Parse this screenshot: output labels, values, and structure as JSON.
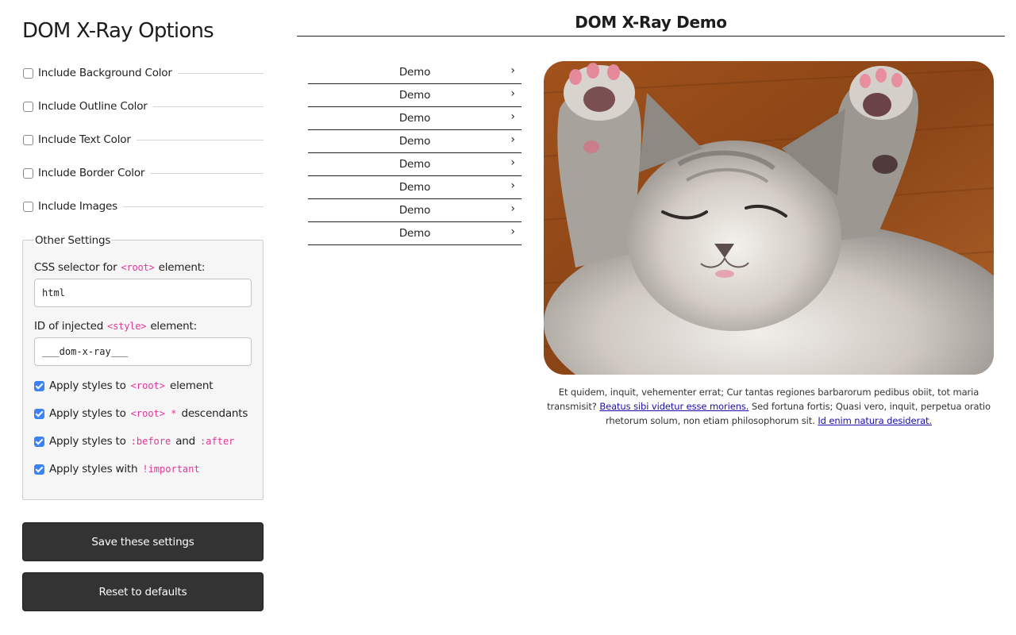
{
  "options": {
    "title": "DOM X-Ray Options",
    "toggles": [
      {
        "label": "Include Background Color",
        "checked": false
      },
      {
        "label": "Include Outline Color",
        "checked": false
      },
      {
        "label": "Include Text Color",
        "checked": false
      },
      {
        "label": "Include Border Color",
        "checked": false
      },
      {
        "label": "Include Images",
        "checked": false
      }
    ],
    "other": {
      "legend": "Other Settings",
      "root_selector": {
        "label_pre": "CSS selector for",
        "code": "<root>",
        "label_post": "element:",
        "value": "html"
      },
      "style_id": {
        "label_pre": "ID of injected",
        "code": "<style>",
        "label_post": "element:",
        "value": "___dom-x-ray___"
      },
      "checks": [
        {
          "pre": "Apply styles to",
          "code": "<root>",
          "post": "element",
          "checked": true
        },
        {
          "pre": "Apply styles to",
          "code": "<root> *",
          "post": "descendants",
          "checked": true
        },
        {
          "pre": "Apply styles to",
          "code": ":before",
          "mid": "and",
          "code2": ":after",
          "checked": true
        },
        {
          "pre": "Apply styles with",
          "code": "!important",
          "checked": true
        }
      ]
    },
    "save_label": "Save these settings",
    "reset_label": "Reset to defaults"
  },
  "demo": {
    "title": "DOM X-Ray Demo",
    "menu": [
      "Demo",
      "Demo",
      "Demo",
      "Demo",
      "Demo",
      "Demo",
      "Demo",
      "Demo"
    ],
    "chevron": "›",
    "image_alt": "sleeping-kitten-photo",
    "caption": {
      "text1": "Et quidem, inquit, vehementer errat; Cur tantas regiones barbarorum pedibus obiit, tot maria transmisit?",
      "link1": "Beatus sibi videtur esse moriens.",
      "text2": "Sed fortuna fortis; Quasi vero, inquit, perpetua oratio rhetorum solum, non etiam philosophorum sit.",
      "link2": "Id enim natura desiderat."
    }
  },
  "colors": {
    "accent": "#3b82f6",
    "code": "#e0379a",
    "button": "#333333",
    "link": "#1a0dab"
  }
}
